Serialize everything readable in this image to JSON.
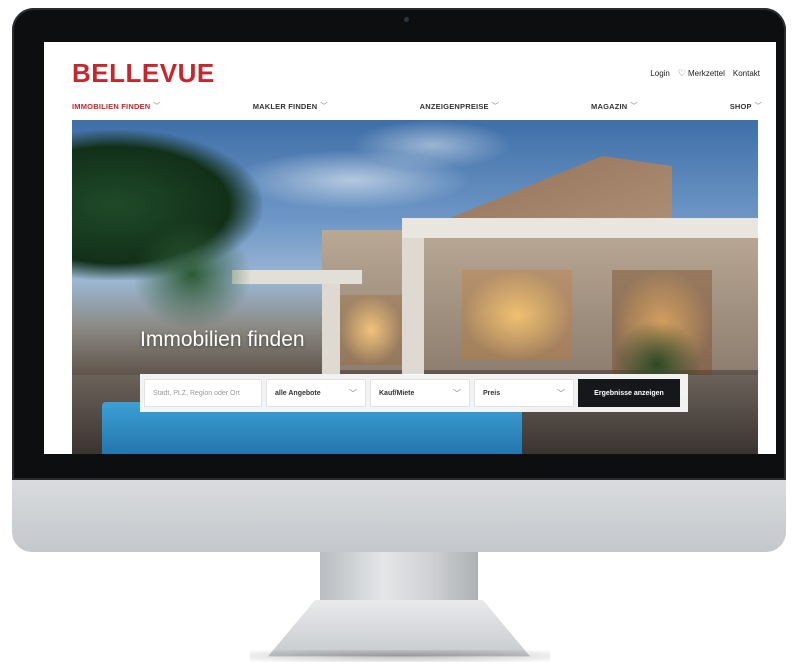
{
  "brand": {
    "name": "BELLEVUE",
    "accent": "#c8262b"
  },
  "utility_nav": {
    "login": "Login",
    "watchlist": "Merkzettel",
    "contact": "Kontakt",
    "watchlist_icon": "heart-icon"
  },
  "main_nav": {
    "items": [
      {
        "label": "IMMOBILIEN FINDEN",
        "active": true
      },
      {
        "label": "MAKLER FINDEN",
        "active": false
      },
      {
        "label": "ANZEIGENPREISE",
        "active": false
      },
      {
        "label": "MAGAZIN",
        "active": false
      },
      {
        "label": "SHOP",
        "active": false
      }
    ],
    "item_icon": "chevron-down-icon"
  },
  "hero": {
    "title": "Immobilien finden"
  },
  "search": {
    "location_placeholder": "Stadt, PLZ, Region oder Ort",
    "offers_value": "alle Angebote",
    "purchase_type_value": "Kauf/Miete",
    "price_value": "Preis",
    "submit_label": "Ergebnisse anzeigen"
  }
}
